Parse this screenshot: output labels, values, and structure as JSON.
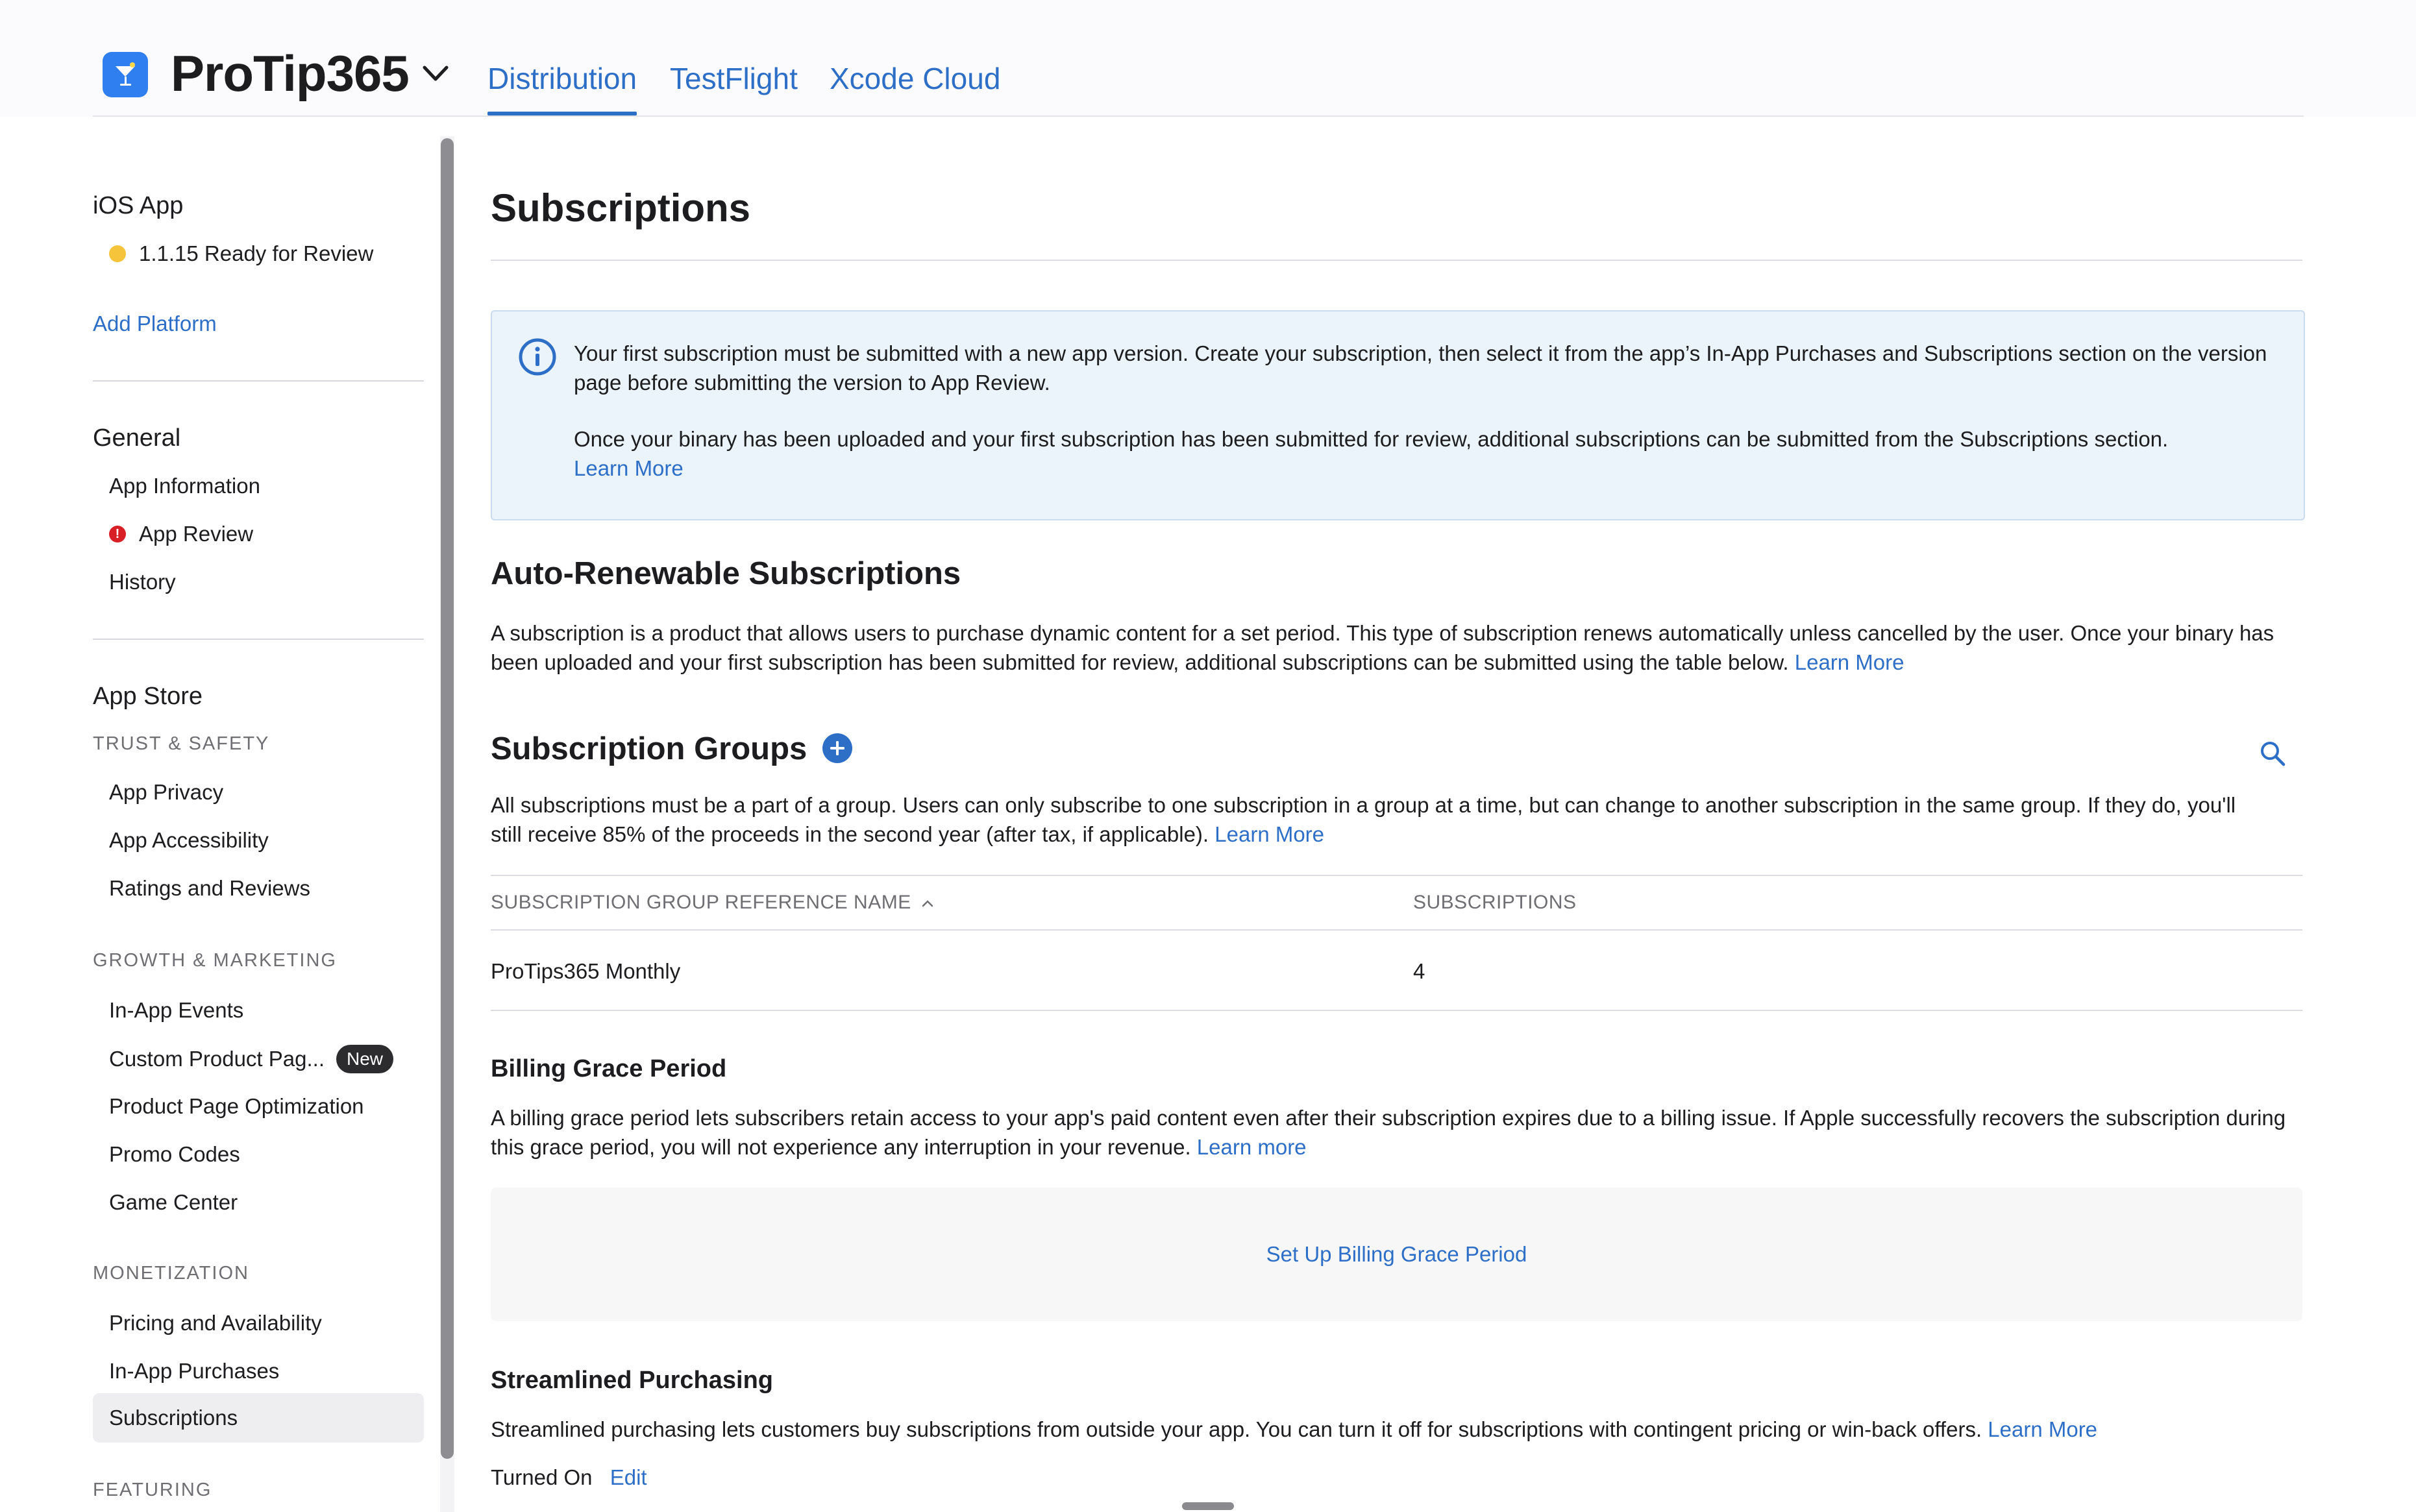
{
  "header": {
    "app_name": "ProTip365",
    "tabs": [
      {
        "label": "Distribution",
        "active": true
      },
      {
        "label": "TestFlight",
        "active": false
      },
      {
        "label": "Xcode Cloud",
        "active": false
      }
    ]
  },
  "sidebar": {
    "ios_app": {
      "heading": "iOS App",
      "version_status": "1.1.15 Ready for Review",
      "add_platform": "Add Platform"
    },
    "general": {
      "heading": "General",
      "items": [
        "App Information",
        "App Review",
        "History"
      ]
    },
    "app_store": {
      "heading": "App Store",
      "trust_safety": {
        "label": "TRUST & SAFETY",
        "items": [
          "App Privacy",
          "App Accessibility",
          "Ratings and Reviews"
        ]
      },
      "growth_marketing": {
        "label": "GROWTH & MARKETING",
        "items": [
          "In-App Events",
          "Custom Product Pag...",
          "Product Page Optimization",
          "Promo Codes",
          "Game Center"
        ],
        "new_badge": "New"
      },
      "monetization": {
        "label": "MONETIZATION",
        "items": [
          "Pricing and Availability",
          "In-App Purchases",
          "Subscriptions"
        ],
        "selected": "Subscriptions"
      },
      "featuring": {
        "label": "FEATURING"
      }
    }
  },
  "main": {
    "title": "Subscriptions",
    "info": {
      "para1": "Your first subscription must be submitted with a new app version. Create your subscription, then select it from the app’s In-App Purchases and Subscriptions section on the version page before submitting the version to App Review.",
      "para2": "Once your binary has been uploaded and your first subscription has been submitted for review, additional subscriptions can be submitted from the Subscriptions section.",
      "learn_more": "Learn More"
    },
    "auto_renewable": {
      "heading": "Auto-Renewable Subscriptions",
      "text": "A subscription is a product that allows users to purchase dynamic content for a set period. This type of subscription renews automatically unless cancelled by the user. Once your binary has been uploaded and your first subscription has been submitted for review, additional subscriptions can be submitted using the table below.",
      "learn_more": "Learn More"
    },
    "groups": {
      "heading": "Subscription Groups",
      "text": "All subscriptions must be a part of a group. Users can only subscribe to one subscription in a group at a time, but can change to another subscription in the same group. If they do, you'll still receive 85% of the proceeds in the second year (after tax, if applicable).",
      "learn_more": "Learn More",
      "columns": [
        "SUBSCRIPTION GROUP REFERENCE NAME",
        "SUBSCRIPTIONS"
      ],
      "sort_indicator": "^",
      "rows": [
        {
          "name": "ProTips365 Monthly",
          "count": "4"
        }
      ]
    },
    "grace": {
      "heading": "Billing Grace Period",
      "text": "A billing grace period lets subscribers retain access to your app's paid content even after their subscription expires due to a billing issue. If Apple successfully recovers the subscription during this grace period, you will not experience any interruption in your revenue.",
      "learn_more": "Learn more",
      "setup_label": "Set Up Billing Grace Period"
    },
    "streamlined": {
      "heading": "Streamlined Purchasing",
      "text": "Streamlined purchasing lets customers buy subscriptions from outside your app. You can turn it off for subscriptions with contingent pricing or win-back offers.",
      "learn_more": "Learn More",
      "status": "Turned On",
      "edit": "Edit"
    }
  },
  "colors": {
    "accent": "#2d6fc7",
    "info_bg": "#ebf3fb",
    "status_yellow": "#f5c43b",
    "status_red": "#d81f25"
  }
}
